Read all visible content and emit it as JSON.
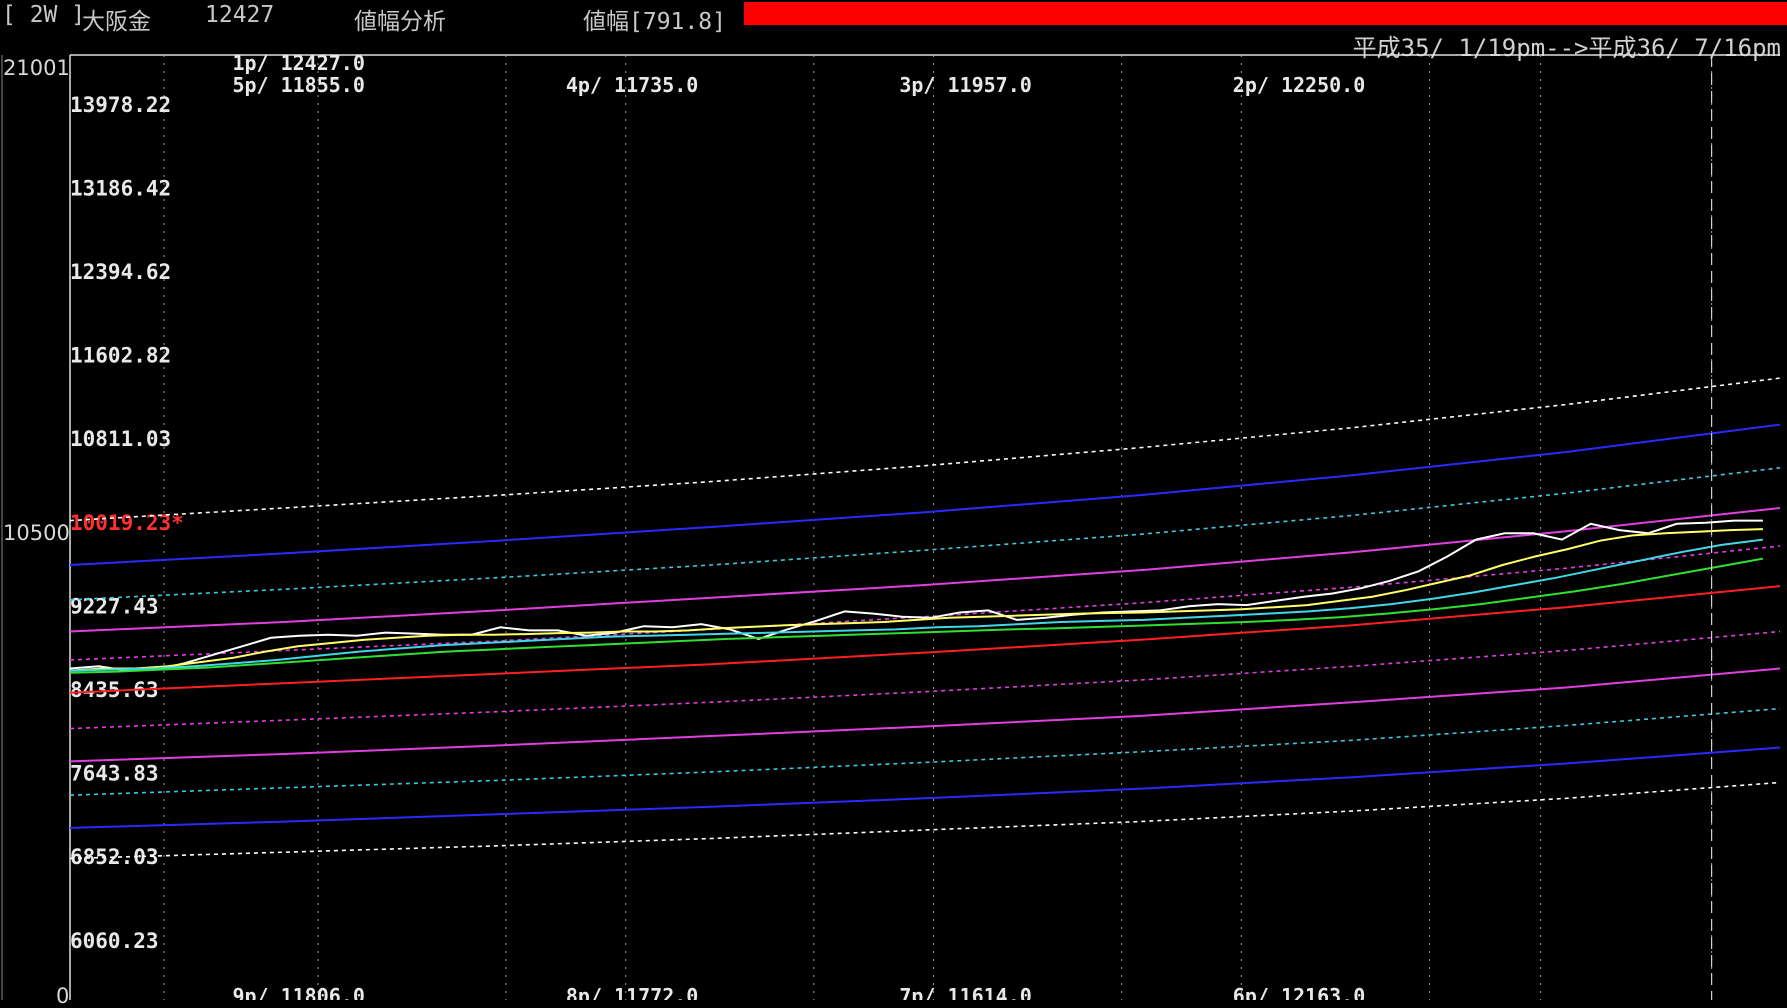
{
  "titlebar": {
    "timeframe": "[ 2W ]",
    "instrument": "大阪金",
    "price": "12427",
    "mode": "値幅分析",
    "range": "値幅[791.8]",
    "accent_color": "#ff0000"
  },
  "date_range": "平成35/ 1/19pm-->平成36/ 7/16pm",
  "left_axis": {
    "top": "21001",
    "mid": "10500",
    "bottom": "0"
  },
  "chart_data": {
    "type": "line",
    "ylim": [
      5500,
      14450
    ],
    "y_ticks": [
      "13978.22",
      "13186.42",
      "12394.62",
      "11602.82",
      "10811.03",
      "10019.23*",
      "9227.43",
      "8435.63",
      "7643.83",
      "6852.03",
      "6060.23"
    ],
    "y_tick_values": [
      13978.22,
      13186.42,
      12394.62,
      11602.82,
      10811.03,
      10019.23,
      9227.43,
      8435.63,
      7643.83,
      6852.03,
      6060.23
    ],
    "highlight_tick": "10019.23*",
    "highlight_color": "#ff3030",
    "top_annotations": [
      "1p/ 12427.0",
      "5p/ 11855.0",
      "4p/ 11735.0",
      "3p/ 11957.0",
      "2p/ 12250.0"
    ],
    "bottom_annotations": [
      "9p/ 11806.0",
      "8p/ 11772.0",
      "7p/ 11614.0",
      "6p/ 12163.0"
    ],
    "x": [
      0,
      10,
      20,
      30,
      40,
      50,
      60,
      70,
      80,
      90,
      100,
      110,
      120,
      130,
      140,
      150,
      160
    ],
    "series": [
      {
        "color": "#ffffff",
        "style": "dashed",
        "values": [
          10040,
          10160,
          10280,
          10410,
          10560,
          10730,
          10920,
          11140,
          11390
        ]
      },
      {
        "color": "#2a2aff",
        "style": "solid",
        "values": [
          9620,
          9730,
          9850,
          9980,
          10120,
          10280,
          10470,
          10690,
          10950
        ]
      },
      {
        "color": "#40c8e0",
        "style": "dashed",
        "values": [
          9290,
          9390,
          9500,
          9620,
          9760,
          9910,
          10090,
          10300,
          10540
        ]
      },
      {
        "color": "#e040e0",
        "style": "solid",
        "values": [
          8990,
          9080,
          9190,
          9310,
          9430,
          9570,
          9740,
          9940,
          10160
        ]
      },
      {
        "color": "#e040e0",
        "style": "dashed",
        "values": [
          8720,
          8810,
          8900,
          9010,
          9130,
          9260,
          9410,
          9590,
          9800
        ]
      },
      {
        "color": "#ff2020",
        "style": "solid",
        "values": [
          8410,
          8500,
          8590,
          8680,
          8790,
          8910,
          9050,
          9220,
          9420
        ]
      },
      {
        "color": "#e040e0",
        "style": "dashed",
        "values": [
          8070,
          8150,
          8230,
          8320,
          8420,
          8530,
          8660,
          8810,
          8990
        ]
      },
      {
        "color": "#e040e0",
        "style": "solid",
        "values": [
          7760,
          7830,
          7910,
          8000,
          8090,
          8190,
          8320,
          8460,
          8640
        ]
      },
      {
        "color": "#40c8e0",
        "style": "dashed",
        "values": [
          7440,
          7510,
          7580,
          7660,
          7750,
          7850,
          7960,
          8100,
          8260
        ]
      },
      {
        "color": "#2a2aff",
        "style": "solid",
        "values": [
          7130,
          7190,
          7260,
          7330,
          7410,
          7500,
          7610,
          7740,
          7890
        ]
      },
      {
        "color": "#ffffff",
        "style": "dashed",
        "values": [
          6840,
          6900,
          6960,
          7030,
          7110,
          7190,
          7290,
          7410,
          7560
        ]
      },
      {
        "color": "#ffffff",
        "style": "solid",
        "values": [
          8640,
          8660,
          8620,
          8630,
          8690,
          8770,
          8850,
          8930,
          8950,
          8960,
          8950,
          8980,
          8970,
          8960,
          8960,
          9030,
          9000,
          9000,
          8950,
          8980,
          9040,
          9030,
          9060,
          9010,
          8920,
          9010,
          9090,
          9180,
          9160,
          9130,
          9120,
          9170,
          9190,
          9100,
          9120,
          9150,
          9170,
          9180,
          9190,
          9230,
          9250,
          9240,
          9280,
          9320,
          9350,
          9400,
          9470,
          9560,
          9700,
          9860,
          9920,
          9920,
          9860,
          10010,
          9950,
          9920,
          10010,
          10020,
          10040,
          10040
        ]
      },
      {
        "color": "#ffff66",
        "style": "solid",
        "values": [
          8620,
          8640,
          8640,
          8660,
          8700,
          8740,
          8800,
          8850,
          8880,
          8910,
          8930,
          8950,
          8960,
          8960,
          8965,
          8975,
          8980,
          8990,
          8990,
          9000,
          9020,
          9035,
          9050,
          9060,
          9070,
          9080,
          9100,
          9120,
          9130,
          9140,
          9150,
          9160,
          9165,
          9170,
          9180,
          9190,
          9200,
          9220,
          9240,
          9280,
          9320,
          9380,
          9450,
          9520,
          9620,
          9700,
          9770,
          9850,
          9900,
          9920,
          9935,
          9950,
          9960
        ]
      },
      {
        "color": "#40d8e8",
        "style": "solid",
        "values": [
          8620,
          8630,
          8640,
          8660,
          8690,
          8720,
          8760,
          8800,
          8830,
          8860,
          8880,
          8900,
          8920,
          8940,
          8950,
          8960,
          8970,
          8980,
          8990,
          9000,
          9010,
          9030,
          9040,
          9060,
          9080,
          9090,
          9100,
          9120,
          9140,
          9160,
          9180,
          9210,
          9250,
          9300,
          9360,
          9430,
          9500,
          9580,
          9660,
          9740,
          9810,
          9860
        ]
      },
      {
        "color": "#30e030",
        "style": "solid",
        "values": [
          8600,
          8610,
          8630,
          8650,
          8680,
          8710,
          8740,
          8770,
          8800,
          8820,
          8840,
          8860,
          8880,
          8900,
          8920,
          8935,
          8950,
          8965,
          8980,
          8995,
          9010,
          9020,
          9035,
          9050,
          9065,
          9080,
          9100,
          9125,
          9160,
          9200,
          9250,
          9310,
          9370,
          9440,
          9520,
          9600,
          9680
        ]
      }
    ]
  }
}
